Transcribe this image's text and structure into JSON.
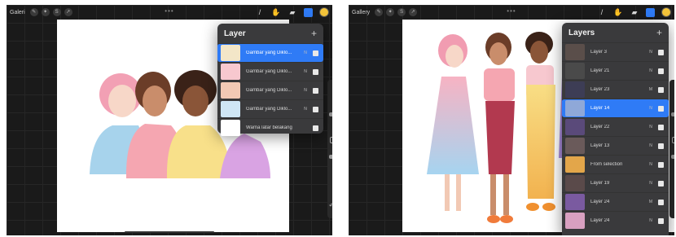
{
  "left": {
    "gallery_label": "Galeri",
    "panel_title": "Layer",
    "layers": [
      {
        "label": "Gambar yang Diklo...",
        "blend": "N",
        "selected": true
      },
      {
        "label": "Gambar yang Diklo...",
        "blend": "N",
        "selected": false
      },
      {
        "label": "Gambar yang Diklo...",
        "blend": "N",
        "selected": false
      },
      {
        "label": "Gambar yang Diklo...",
        "blend": "N",
        "selected": false
      },
      {
        "label": "Warna latar belakang",
        "blend": "",
        "selected": false
      }
    ]
  },
  "right": {
    "gallery_label": "Gallery",
    "panel_title": "Layers",
    "layers": [
      {
        "label": "Layer 3",
        "blend": "N",
        "selected": false
      },
      {
        "label": "Layer 21",
        "blend": "N",
        "selected": false
      },
      {
        "label": "Layer 23",
        "blend": "M",
        "selected": false
      },
      {
        "label": "Layer 14",
        "blend": "N",
        "selected": true
      },
      {
        "label": "Layer 22",
        "blend": "N",
        "selected": false
      },
      {
        "label": "Layer 13",
        "blend": "N",
        "selected": false
      },
      {
        "label": "From selection",
        "blend": "N",
        "selected": false
      },
      {
        "label": "Layer 19",
        "blend": "N",
        "selected": false
      },
      {
        "label": "Layer 24",
        "blend": "M",
        "selected": false
      },
      {
        "label": "Layer 24",
        "blend": "N",
        "selected": false
      }
    ]
  },
  "icons": {
    "add": "+",
    "more": "•••"
  },
  "colors": {
    "accent_blue": "#2f7bf6",
    "panel_bg": "#3a3a3c",
    "color_swatch": "#f3c43a"
  }
}
